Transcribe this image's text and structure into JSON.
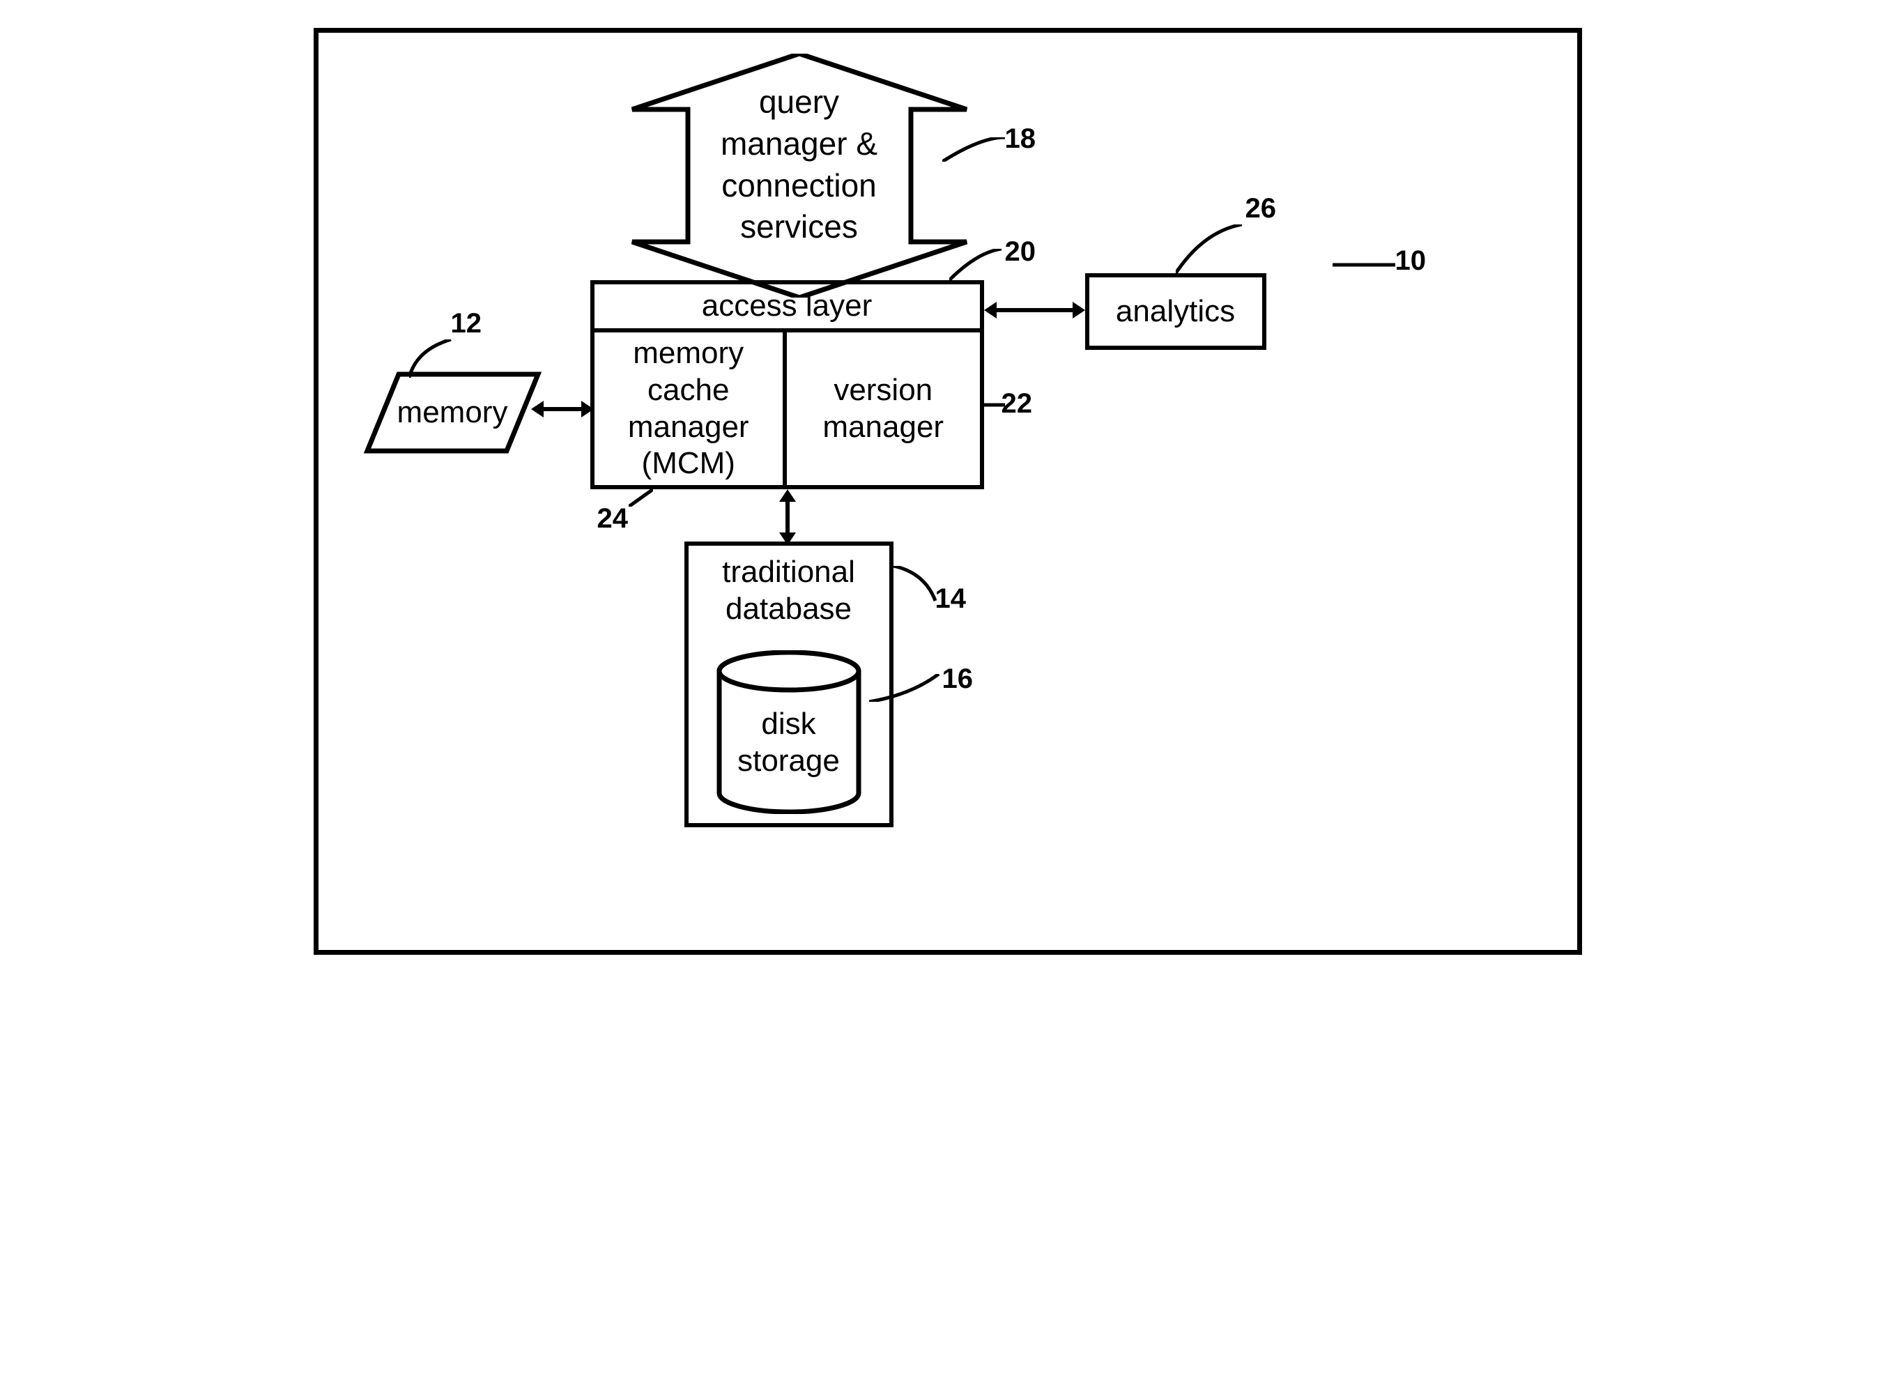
{
  "diagram": {
    "big_arrow_text": "query\nmanager &\nconnection\nservices",
    "access_layer": "access layer",
    "mcm": "memory\ncache\nmanager\n(MCM)",
    "version_manager": "version\nmanager",
    "memory": "memory",
    "analytics": "analytics",
    "traditional_db": "traditional\ndatabase",
    "disk_storage": "disk\nstorage"
  },
  "labels": {
    "l10": "10",
    "l12": "12",
    "l14": "14",
    "l16": "16",
    "l18": "18",
    "l20": "20",
    "l22": "22",
    "l24": "24",
    "l26": "26"
  }
}
